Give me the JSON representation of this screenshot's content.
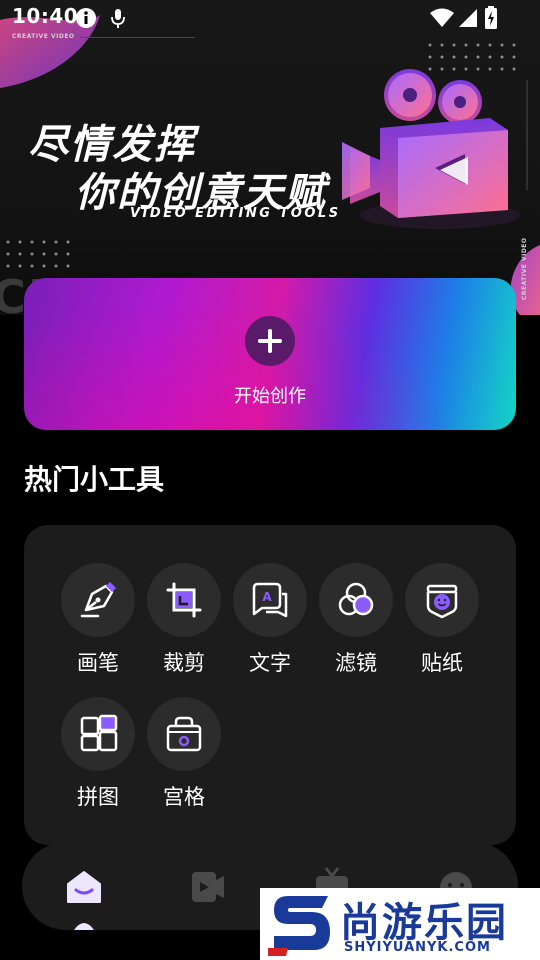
{
  "status_bar": {
    "time": "10:40",
    "icons": [
      "info-icon",
      "mic-icon",
      "wifi-icon",
      "signal-icon",
      "battery-icon"
    ]
  },
  "banner": {
    "corner_tag": "CREATIVE VIDEO",
    "vertical_tag": "CREATIVE VIDEO",
    "title_line_1": "尽情发挥",
    "title_line_2": "你的创意天赋",
    "subtitle": "VIDEO EDITING TOOLS",
    "watermark": "CR",
    "camera_icon": "video-camera-icon"
  },
  "create": {
    "label": "开始创作",
    "icon": "plus-icon"
  },
  "section": {
    "title": "热门小工具"
  },
  "tools": [
    {
      "label": "画笔",
      "icon": "brush-icon"
    },
    {
      "label": "裁剪",
      "icon": "crop-icon"
    },
    {
      "label": "文字",
      "icon": "text-bubble-icon"
    },
    {
      "label": "滤镜",
      "icon": "filter-icon"
    },
    {
      "label": "贴纸",
      "icon": "sticker-icon"
    },
    {
      "label": "拼图",
      "icon": "collage-icon"
    },
    {
      "label": "宫格",
      "icon": "grid-bag-icon"
    }
  ],
  "bottom_nav": {
    "items": [
      "home-icon",
      "video-icon",
      "tv-icon",
      "face-icon"
    ],
    "active": "home-icon"
  },
  "site_logo": {
    "name": "尚游乐园",
    "url": "SHYIYUANYK.COM"
  },
  "colors": {
    "accent": "#7b4dff",
    "panel": "#1c1c1c",
    "tool_circle": "#2c2c2c",
    "logo_blue": "#1a3a9a"
  }
}
